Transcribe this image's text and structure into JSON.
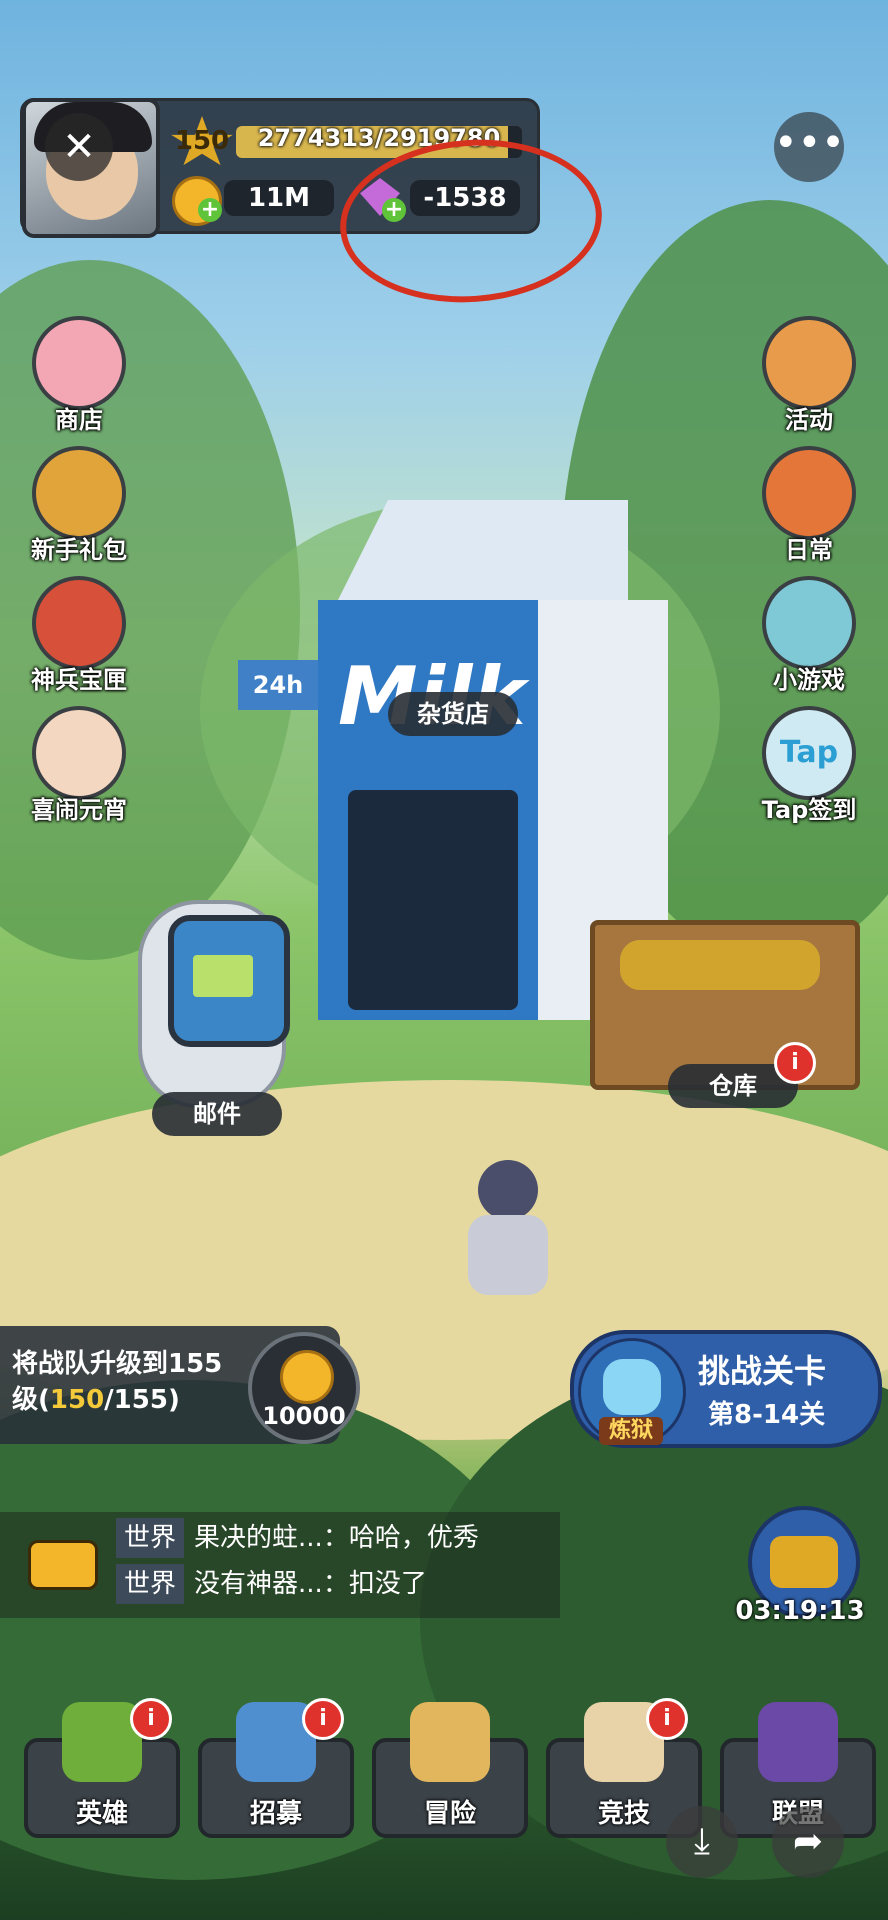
{
  "player": {
    "level": "150",
    "exp_text": "2774313/2919780",
    "gold": "11M",
    "gems": "-1538"
  },
  "side_left": [
    {
      "label": "商店",
      "icon": "shop-icon"
    },
    {
      "label": "新手礼包",
      "icon": "newbie-pack-icon"
    },
    {
      "label": "神兵宝匣",
      "icon": "weapon-box-icon"
    },
    {
      "label": "喜闹元宵",
      "icon": "lantern-festival-icon"
    }
  ],
  "side_right": [
    {
      "label": "活动",
      "icon": "events-icon"
    },
    {
      "label": "日常",
      "icon": "daily-icon"
    },
    {
      "label": "小游戏",
      "icon": "minigame-icon"
    },
    {
      "label": "Tap签到",
      "icon": "tap-checkin-icon"
    }
  ],
  "scene": {
    "shop_label": "杂货店",
    "carton_24h": "24h",
    "carton_brand": "Milk",
    "mail_label": "邮件",
    "warehouse_label": "仓库",
    "warehouse_badge": "i",
    "tap_logo": "Tap"
  },
  "quest": {
    "text_prefix": "将战队升级到155级(",
    "progress_current": "150",
    "text_suffix": "/155)",
    "reward": "10000"
  },
  "challenge": {
    "title": "挑战关卡",
    "subtitle": "第8-14关",
    "mode": "炼狱"
  },
  "chat": [
    {
      "channel": "世界",
      "name": "果决的蛀...",
      "message": "哈哈，优秀"
    },
    {
      "channel": "世界",
      "name": "没有神器...",
      "message": "扣没了"
    }
  ],
  "timer": "03:19:13",
  "bottom_nav": [
    {
      "label": "英雄",
      "icon": "hero-icon",
      "badge": "i"
    },
    {
      "label": "招募",
      "icon": "recruit-icon",
      "badge": "i"
    },
    {
      "label": "冒险",
      "icon": "adventure-icon",
      "badge": ""
    },
    {
      "label": "竞技",
      "icon": "arena-icon",
      "badge": "i"
    },
    {
      "label": "联盟",
      "icon": "alliance-icon",
      "badge": ""
    }
  ],
  "colors": {
    "gem": "#c46ad9",
    "gold": "#f3b62b",
    "annotation_circle": "#d6301f",
    "exp_bar": "#d8b64e",
    "challenge_panel": "#2f5fa8",
    "progress_highlight": "#f4c93a"
  }
}
